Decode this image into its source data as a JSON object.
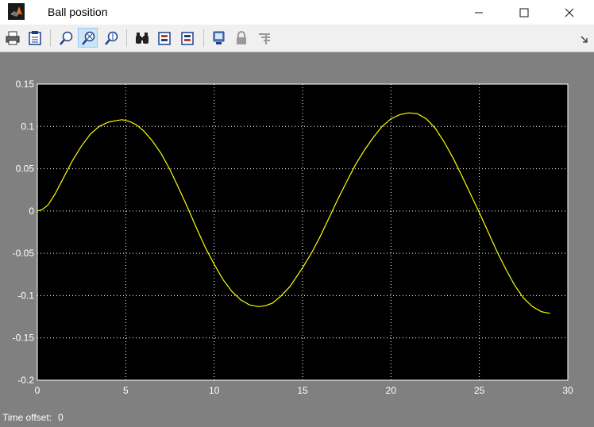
{
  "window": {
    "title": "Ball position",
    "minimize_glyph": "—",
    "maximize_glyph": "☐",
    "close_glyph": "✕"
  },
  "toolbar": {
    "buttons": [
      {
        "name": "print-icon"
      },
      {
        "name": "print-to-figure-icon"
      },
      {
        "name": "zoom-in-icon"
      },
      {
        "name": "zoom-x-icon",
        "active": true
      },
      {
        "name": "zoom-y-icon"
      },
      {
        "name": "find-icon"
      },
      {
        "name": "autoscale-icon"
      },
      {
        "name": "save-axes-settings-icon"
      },
      {
        "name": "scope-parameters-icon"
      },
      {
        "name": "lock-axes-icon"
      },
      {
        "name": "signal-selection-icon"
      }
    ]
  },
  "status": {
    "label": "Time offset:",
    "value": "0"
  },
  "colors": {
    "plot_background": "#000000",
    "figure_background": "#808080",
    "trace": "#ffff00",
    "grid": "#ffffff"
  },
  "chart_data": {
    "type": "line",
    "xlim": [
      0,
      30
    ],
    "ylim": [
      -0.2,
      0.15
    ],
    "x_ticks": [
      "0",
      "5",
      "10",
      "15",
      "20",
      "25",
      "30"
    ],
    "y_ticks": [
      "0.15",
      "0.1",
      "0.05",
      "0",
      "-0.05",
      "-0.1",
      "-0.15",
      "-0.2"
    ],
    "grid": true,
    "series": [
      {
        "color": "#ffff00",
        "x": [
          0,
          0.3,
          0.6,
          1,
          1.5,
          2,
          2.5,
          3,
          3.5,
          4,
          4.5,
          4.8,
          5.2,
          5.6,
          6,
          6.5,
          7,
          7.5,
          8,
          8.5,
          9,
          9.5,
          10,
          10.5,
          11,
          11.5,
          12,
          12.5,
          12.9,
          13.3,
          13.8,
          14.3,
          15,
          15.5,
          16,
          16.5,
          17,
          17.5,
          18,
          18.5,
          19,
          19.5,
          20,
          20.5,
          21,
          21.5,
          22,
          22.5,
          23,
          23.5,
          24,
          24.5,
          25,
          25.5,
          26,
          26.5,
          27,
          27.5,
          28,
          28.5,
          29
        ],
        "y": [
          0,
          0.002,
          0.007,
          0.02,
          0.04,
          0.06,
          0.077,
          0.091,
          0.1,
          0.105,
          0.107,
          0.108,
          0.106,
          0.102,
          0.095,
          0.083,
          0.068,
          0.049,
          0.027,
          0.004,
          -0.02,
          -0.043,
          -0.063,
          -0.081,
          -0.095,
          -0.105,
          -0.111,
          -0.113,
          -0.112,
          -0.109,
          -0.1,
          -0.089,
          -0.067,
          -0.05,
          -0.03,
          -0.008,
          0.014,
          0.035,
          0.055,
          0.072,
          0.087,
          0.1,
          0.109,
          0.114,
          0.116,
          0.115,
          0.109,
          0.098,
          0.082,
          0.063,
          0.042,
          0.02,
          -0.002,
          -0.025,
          -0.048,
          -0.069,
          -0.088,
          -0.103,
          -0.113,
          -0.119,
          -0.121
        ]
      }
    ]
  }
}
